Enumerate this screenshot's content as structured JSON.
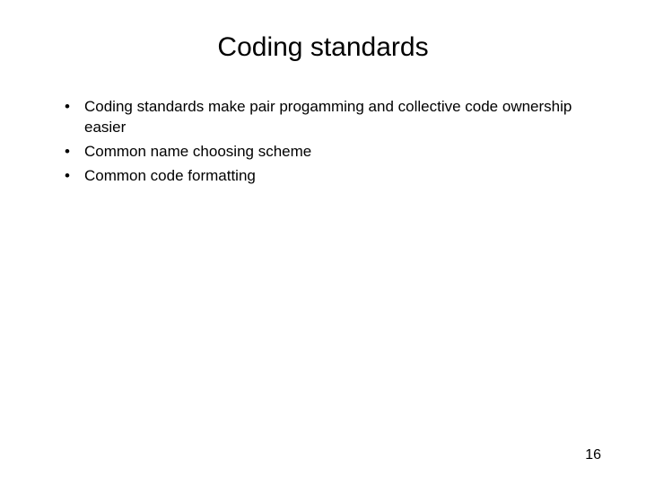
{
  "title": "Coding standards",
  "bullets": {
    "item0": "Coding standards make pair progamming and collective code ownership easier",
    "item1": "Common name choosing scheme",
    "item2": "Common code formatting"
  },
  "page_number": "16"
}
